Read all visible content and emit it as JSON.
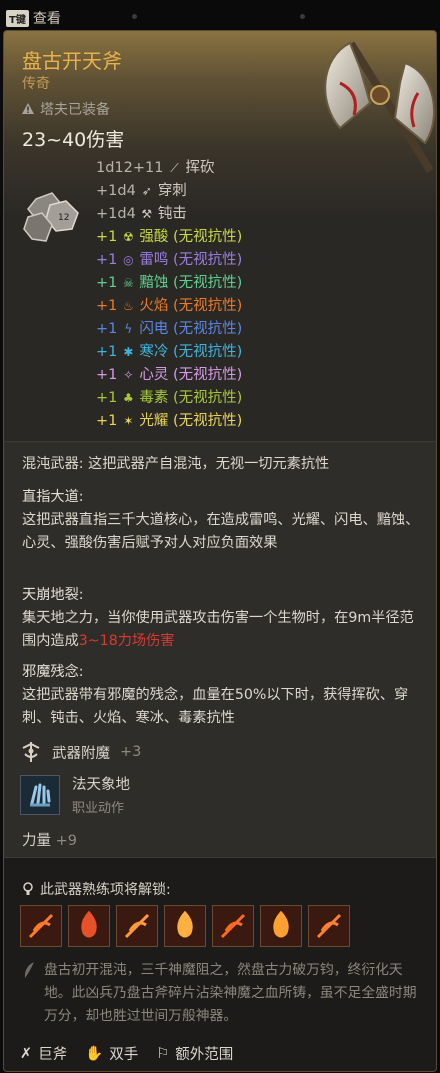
{
  "topbar": {
    "key": "T键",
    "label": "查看"
  },
  "item": {
    "name": "盘古开天斧",
    "rarity": "传奇",
    "equipped": "塔夫已装备",
    "damage": "23~40伤害"
  },
  "damage_rows": [
    {
      "amount": "1d12+11",
      "icon": "slash-icon",
      "glyph": "⟋",
      "type": "挥砍",
      "suffix": "",
      "color": "#cfc9bf",
      "amountColor": "#b9b4ab"
    },
    {
      "amount": "+1d4",
      "icon": "pierce-icon",
      "glyph": "➶",
      "type": "穿刺",
      "suffix": "",
      "color": "#cfc9bf",
      "amountColor": "#b9b4ab"
    },
    {
      "amount": "+1d4",
      "icon": "bludgeon-icon",
      "glyph": "⚒",
      "type": "钝击",
      "suffix": "",
      "color": "#cfc9bf",
      "amountColor": "#b9b4ab"
    },
    {
      "amount": "+1",
      "icon": "acid-icon",
      "glyph": "☢",
      "type": "强酸",
      "suffix": " (无视抗性)",
      "color": "#c8d848",
      "amountColor": "#c8d848"
    },
    {
      "amount": "+1",
      "icon": "thunder-icon",
      "glyph": "◎",
      "type": "雷鸣",
      "suffix": " (无视抗性)",
      "color": "#9b7de0",
      "amountColor": "#9b7de0"
    },
    {
      "amount": "+1",
      "icon": "necrotic-icon",
      "glyph": "☠",
      "type": "黯蚀",
      "suffix": " (无视抗性)",
      "color": "#5fd090",
      "amountColor": "#5fd090"
    },
    {
      "amount": "+1",
      "icon": "fire-icon",
      "glyph": "♨",
      "type": "火焰",
      "suffix": " (无视抗性)",
      "color": "#ea7a2a",
      "amountColor": "#ea7a2a"
    },
    {
      "amount": "+1",
      "icon": "lightning-icon",
      "glyph": "ϟ",
      "type": "闪电",
      "suffix": " (无视抗性)",
      "color": "#5b86e0",
      "amountColor": "#5b86e0"
    },
    {
      "amount": "+1",
      "icon": "cold-icon",
      "glyph": "✱",
      "type": "寒冷",
      "suffix": " (无视抗性)",
      "color": "#3fb4de",
      "amountColor": "#3fb4de"
    },
    {
      "amount": "+1",
      "icon": "psychic-icon",
      "glyph": "✧",
      "type": "心灵",
      "suffix": " (无视抗性)",
      "color": "#d49ae6",
      "amountColor": "#d49ae6"
    },
    {
      "amount": "+1",
      "icon": "poison-icon",
      "glyph": "♣",
      "type": "毒素",
      "suffix": " (无视抗性)",
      "color": "#a8c83a",
      "amountColor": "#a8c83a"
    },
    {
      "amount": "+1",
      "icon": "radiant-icon",
      "glyph": "✶",
      "type": "光耀",
      "suffix": " (无视抗性)",
      "color": "#e8d45a",
      "amountColor": "#e8d45a"
    }
  ],
  "properties": {
    "chaos": "混沌武器: 这把武器产自混沌，无视一切元素抗性",
    "dao_title": "直指大道:",
    "dao_text": "这把武器直指三千大道核心，在造成雷鸣、光耀、闪电、黯蚀、心灵、强酸伤害后赋予对人对应负面效果",
    "rift_title": "天崩地裂:",
    "rift_text_1": "集天地之力，当你使用武器攻击伤害一个生物时，在9m半径范围内造成",
    "rift_text_red": "3~18力场伤害",
    "evil_title": "邪魔残念:",
    "evil_text": "这把武器带有邪魔的残念，血量在50%以下时，获得挥砍、穿刺、钝击、火焰、寒冰、毒素抗性"
  },
  "enchant": {
    "label": "武器附魔",
    "value": "+3"
  },
  "skill": {
    "name": "法天象地",
    "type": "职业动作"
  },
  "strength": {
    "label": "力量",
    "value": "+9"
  },
  "unlock": {
    "label": "此武器熟练项将解锁:"
  },
  "weapon_actions": [
    "action-1",
    "action-2",
    "action-3",
    "action-4",
    "action-5",
    "action-6",
    "action-7"
  ],
  "lore": "盘古初开混沌，三千神魔阻之，然盘古力破万钧，终衍化天地。此凶兵乃盘古斧碎片沾染神魔之血所铸，虽不足全盛时期万分，却也胜过世间万般神器。",
  "tags": [
    {
      "icon": "greataxe-icon",
      "glyph": "✗",
      "label": "巨斧"
    },
    {
      "icon": "two-handed-icon",
      "glyph": "✋",
      "label": "双手"
    },
    {
      "icon": "reach-icon",
      "glyph": "⚐",
      "label": "额外范围"
    }
  ]
}
